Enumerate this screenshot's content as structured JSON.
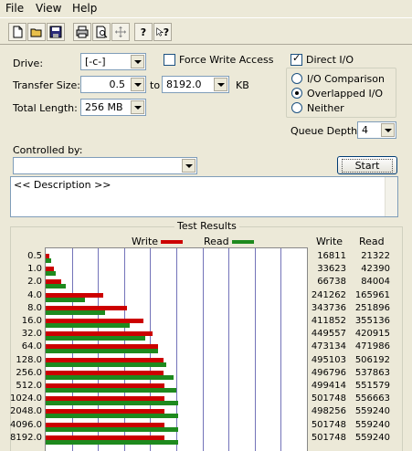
{
  "menu": [
    "File",
    "View",
    "Help"
  ],
  "toolbar": {
    "buttons": [
      "new-document-icon",
      "open-folder-icon",
      "save-icon",
      "print-icon",
      "print-preview-icon",
      "move-icon",
      "help-icon",
      "context-help-icon"
    ],
    "help_glyph": "?",
    "context_help_glyph": "?"
  },
  "settings": {
    "drive_label": "Drive:",
    "drive_value": "[-c-]",
    "transfer_size_label": "Transfer Size:",
    "transfer_from": "0.5",
    "to_label": "to",
    "transfer_to": "8192.0",
    "kb_label": "KB",
    "total_length_label": "Total Length:",
    "total_length_value": "256 MB",
    "force_write_label": "Force Write Access",
    "direct_io_label": "Direct I/O",
    "io_comparison_label": "I/O Comparison",
    "overlapped_io_label": "Overlapped I/O",
    "neither_label": "Neither",
    "queue_depth_label": "Queue Depth:",
    "queue_depth_value": "4",
    "controlled_by_label": "Controlled by:",
    "controlled_by_value": "",
    "start_label": "Start",
    "force_write_checked": false,
    "direct_io_checked": true,
    "io_mode_selected": "Overlapped I/O"
  },
  "description": "<< Description >>",
  "results": {
    "title": "Test Results",
    "legend_write": "Write",
    "legend_read": "Read",
    "col_write": "Write",
    "col_read": "Read",
    "write_color": "#cc0000",
    "read_color": "#1e8a1e"
  },
  "chart_data": {
    "type": "bar",
    "orientation": "horizontal",
    "categories": [
      "0.5",
      "1.0",
      "2.0",
      "4.0",
      "8.0",
      "16.0",
      "32.0",
      "64.0",
      "128.0",
      "256.0",
      "512.0",
      "1024.0",
      "2048.0",
      "4096.0",
      "8192.0"
    ],
    "series": [
      {
        "name": "Write",
        "values": [
          16811,
          33623,
          66738,
          241262,
          343736,
          411852,
          449557,
          473134,
          495103,
          496796,
          499414,
          501748,
          498256,
          501748,
          501748
        ]
      },
      {
        "name": "Read",
        "values": [
          21322,
          42390,
          84004,
          165961,
          251896,
          355136,
          420915,
          471986,
          506192,
          537863,
          551579,
          556663,
          559240,
          559240,
          559240
        ]
      }
    ],
    "xlim": [
      0,
      1100000
    ],
    "grid": true,
    "legend": "top"
  }
}
